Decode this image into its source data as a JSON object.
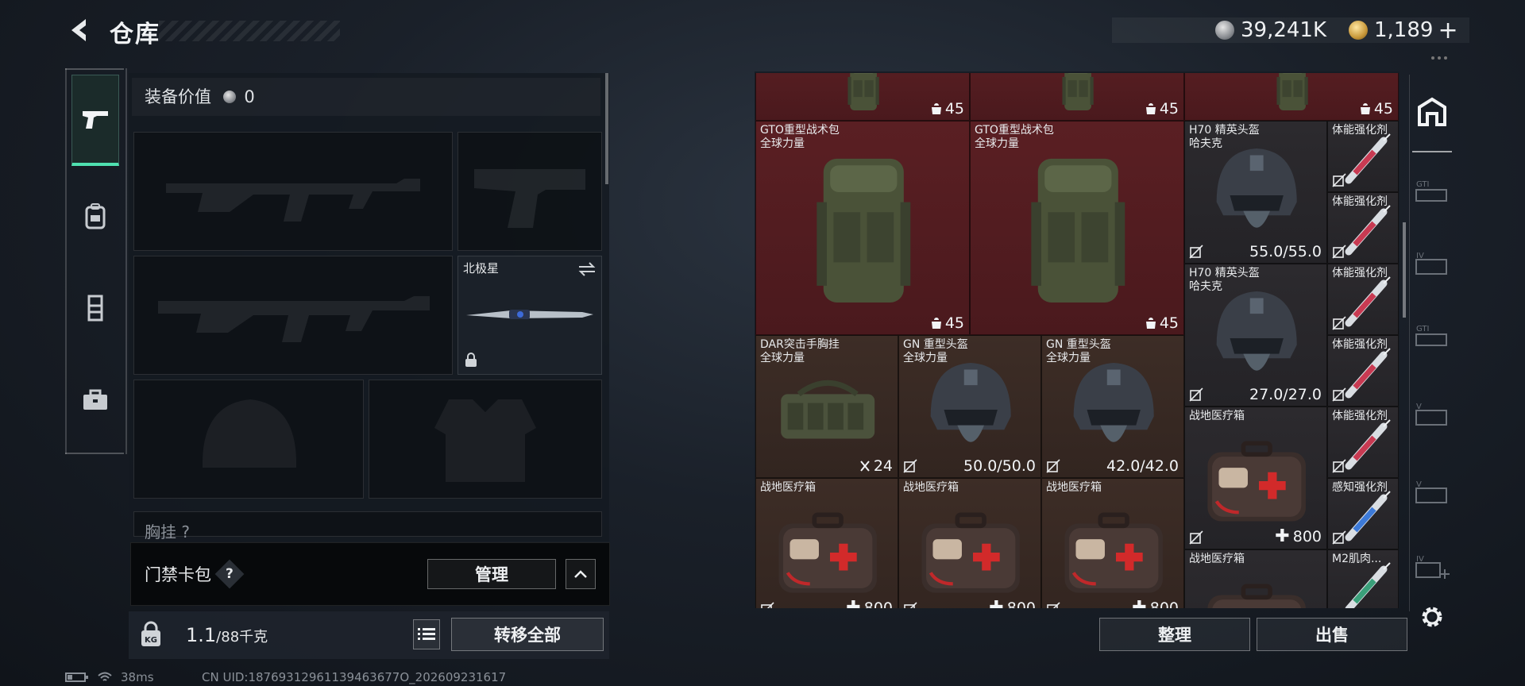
{
  "header": {
    "title": "仓库"
  },
  "currency": {
    "silver": "39,241K",
    "gold": "1,189",
    "gold_plus": "+"
  },
  "loadout": {
    "equip_value_label": "装备价值",
    "equip_value": "0",
    "melee_slot_name": "北极星",
    "below_section_label": "胸挂 ?"
  },
  "keycard": {
    "label": "门禁卡包",
    "help": "?",
    "manage_label": "管理"
  },
  "weight": {
    "current": "1.1",
    "capacity": "/88千克",
    "transfer_all_label": "转移全部"
  },
  "status": {
    "ping": "38ms",
    "uid": "CN UID:18769312961139463677O_202609231617"
  },
  "stash": {
    "sort_label": "整理",
    "sell_label": "出售",
    "items": [
      {
        "name": "",
        "value": "45",
        "icon": "backpack-icon"
      },
      {
        "name": "",
        "value": "45",
        "icon": "backpack-icon"
      },
      {
        "name": "",
        "value": "45",
        "icon": "backpack-icon"
      },
      {
        "name": "GTO重型战术包\n全球力量",
        "value": "45",
        "icon": "backpack-icon"
      },
      {
        "name": "GTO重型战术包\n全球力量",
        "value": "45",
        "icon": "backpack-icon"
      },
      {
        "name": "H70 精英头盔\n哈夫克",
        "value": "55.0/55.0",
        "icon": "helmet-icon"
      },
      {
        "name": "H70 精英头盔\n哈夫克",
        "value": "27.0/27.0",
        "icon": "helmet-icon"
      },
      {
        "name": "DAR突击手胸挂\n全球力量",
        "value": "24",
        "icon": "chest-rig-icon"
      },
      {
        "name": "GN 重型头盔\n全球力量",
        "value": "50.0/50.0",
        "icon": "helmet-icon"
      },
      {
        "name": "GN 重型头盔\n全球力量",
        "value": "42.0/42.0",
        "icon": "helmet-icon"
      },
      {
        "name": "战地医疗箱",
        "value": "800",
        "icon": "medkit-icon"
      },
      {
        "name": "战地医疗箱",
        "value": "",
        "icon": "medkit-icon"
      },
      {
        "name": "战地医疗箱",
        "value": "800",
        "icon": "medkit-icon"
      },
      {
        "name": "战地医疗箱",
        "value": "800",
        "icon": "medkit-icon"
      },
      {
        "name": "战地医疗箱",
        "value": "800",
        "icon": "medkit-icon"
      }
    ],
    "syringes": [
      {
        "name": "体能强化剂"
      },
      {
        "name": "体能强化剂"
      },
      {
        "name": "体能强化剂"
      },
      {
        "name": "体能强化剂"
      },
      {
        "name": "体能强化剂"
      },
      {
        "name": "感知强化剂"
      },
      {
        "name": "M2肌肉..."
      }
    ]
  },
  "colors": {
    "accent": "#4fe0b0",
    "stash_red": "#5a1f23",
    "stash_brown": "#3d2d26"
  }
}
